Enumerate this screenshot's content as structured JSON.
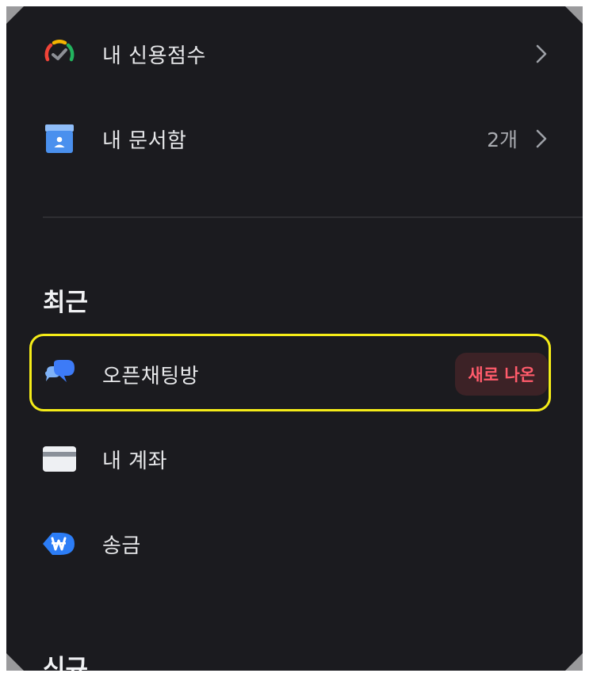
{
  "menu": {
    "credit_score": {
      "label": "내 신용점수",
      "icon": "credit-gauge-icon"
    },
    "documents": {
      "label": "내 문서함",
      "count": "2개",
      "icon": "document-box-icon"
    }
  },
  "recent": {
    "title": "최근",
    "items": [
      {
        "label": "오픈채팅방",
        "badge": "새로 나온",
        "icon": "chat-bubbles-icon"
      },
      {
        "label": "내 계좌",
        "icon": "card-icon"
      },
      {
        "label": "송금",
        "icon": "won-send-icon"
      }
    ]
  },
  "next_section": {
    "title": "신규"
  },
  "colors": {
    "background": "#1b1b1f",
    "highlight": "#f5ec18",
    "badge_text": "#ff5b6b",
    "badge_bg": "#3c2226",
    "accent_blue": "#3d7bf7"
  }
}
